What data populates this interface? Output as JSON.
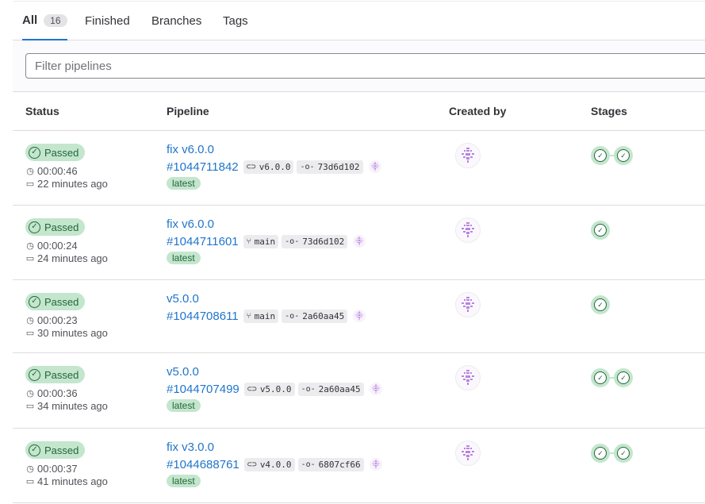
{
  "tabs": [
    {
      "label": "All",
      "count": "16"
    },
    {
      "label": "Finished"
    },
    {
      "label": "Branches"
    },
    {
      "label": "Tags"
    }
  ],
  "filter": {
    "placeholder": "Filter pipelines"
  },
  "columns": {
    "status": "Status",
    "pipeline": "Pipeline",
    "created_by": "Created by",
    "stages": "Stages"
  },
  "colors": {
    "accent": "#1f75cb",
    "success_bg": "#c3e6cd",
    "success_fg": "#24663b"
  },
  "rows": [
    {
      "status": "Passed",
      "duration": "00:00:46",
      "time_ago": "22 minutes ago",
      "title": "fix v6.0.0",
      "id": "#1044711842",
      "ref_icon": "tag-icon",
      "ref": "v6.0.0",
      "commit": "73d6d102",
      "latest": "latest",
      "stage_count": 2
    },
    {
      "status": "Passed",
      "duration": "00:00:24",
      "time_ago": "24 minutes ago",
      "title": "fix v6.0.0",
      "id": "#1044711601",
      "ref_icon": "branch-icon",
      "ref": "main",
      "commit": "73d6d102",
      "latest": "latest",
      "stage_count": 1
    },
    {
      "status": "Passed",
      "duration": "00:00:23",
      "time_ago": "30 minutes ago",
      "title": "v5.0.0",
      "id": "#1044708611",
      "ref_icon": "branch-icon",
      "ref": "main",
      "commit": "2a60aa45",
      "stage_count": 1
    },
    {
      "status": "Passed",
      "duration": "00:00:36",
      "time_ago": "34 minutes ago",
      "title": "v5.0.0",
      "id": "#1044707499",
      "ref_icon": "tag-icon",
      "ref": "v5.0.0",
      "commit": "2a60aa45",
      "latest": "latest",
      "stage_count": 2
    },
    {
      "status": "Passed",
      "duration": "00:00:37",
      "time_ago": "41 minutes ago",
      "title": "fix v3.0.0",
      "id": "#1044688761",
      "ref_icon": "tag-icon",
      "ref": "v4.0.0",
      "commit": "6807cf66",
      "latest": "latest",
      "stage_count": 2
    }
  ]
}
